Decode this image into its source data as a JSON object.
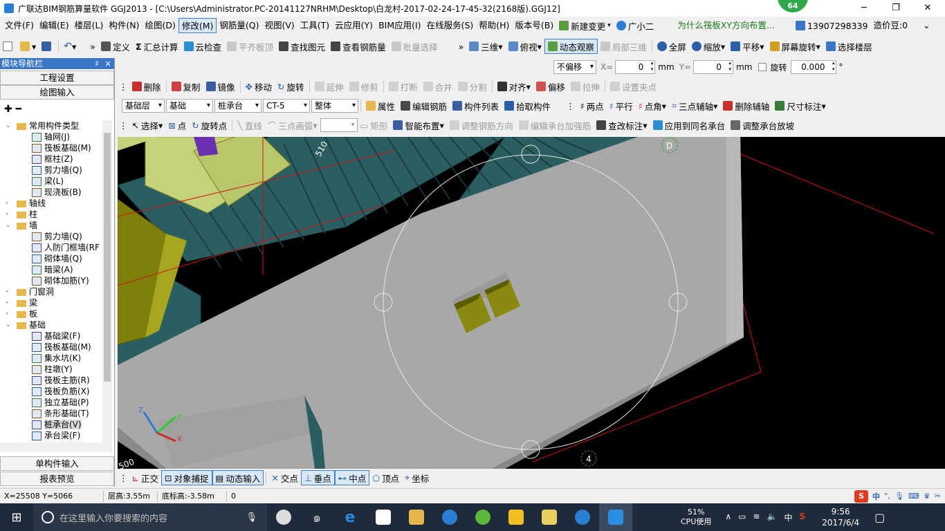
{
  "title_bar": {
    "title": "广联达BIM钢筋算量软件 GGJ2013 - [C:\\Users\\Administrator.PC-20141127NRHM\\Desktop\\白龙村-2017-02-24-17-45-32(2168版).GGJ12]",
    "badge": "64",
    "minimize": "─",
    "restore": "❐",
    "close": "✕"
  },
  "menu": {
    "items": [
      "文件(F)",
      "编辑(E)",
      "楼层(L)",
      "构件(N)",
      "绘图(D)",
      "修改(M)",
      "钢筋量(Q)",
      "视图(V)",
      "工具(T)",
      "云应用(Y)",
      "BIM应用(I)",
      "在线服务(S)",
      "帮助(H)",
      "版本号(B)",
      "新建变更",
      "广小二"
    ],
    "active": "修改(M)",
    "question": "为什么筏板XY方向布置...",
    "phone": "13907298339",
    "price": "造价豆:0"
  },
  "toolbar1": {
    "items": [
      "定义",
      "汇总计算",
      "云检查",
      "平齐板顶",
      "查找图元",
      "查看钢筋量",
      "批量选择",
      "三维",
      "俯视",
      "动态观察",
      "局部三维",
      "全屏",
      "缩放",
      "平移",
      "屏幕旋转",
      "选择楼层"
    ]
  },
  "toolbar_offset": {
    "mode": "不偏移",
    "x_label": "X=",
    "x_value": "0",
    "mm1": "mm",
    "y_label": "Y=",
    "y_value": "0",
    "mm2": "mm",
    "rotate_label": "旋转",
    "rotate_value": "0.000",
    "degree": "°"
  },
  "toolbar2": {
    "items": [
      "删除",
      "复制",
      "镜像",
      "移动",
      "旋转",
      "延伸",
      "修剪",
      "打断",
      "合并",
      "分割",
      "对齐",
      "偏移",
      "拉伸",
      "设置夹点"
    ]
  },
  "toolbar3": {
    "floor": "基础层",
    "category": "基础",
    "type": "桩承台",
    "name": "CT-5",
    "scope": "整体",
    "items": [
      "属性",
      "编辑钢筋",
      "构件列表",
      "拾取构件",
      "两点",
      "平行",
      "点角",
      "三点辅轴",
      "删除辅轴",
      "尺寸标注"
    ]
  },
  "toolbar4": {
    "items": [
      "选择",
      "点",
      "旋转点",
      "直线",
      "三点画弧",
      "矩形",
      "智能布置",
      "调整钢筋方向",
      "编辑承台加强筋",
      "查改标注",
      "应用到同名承台",
      "调整承台放坡"
    ]
  },
  "nav_panel": {
    "header": "模块导航栏",
    "pin": "♯",
    "close_glyph": "×",
    "buttons": [
      "工程设置",
      "绘图输入"
    ],
    "bottom_buttons": [
      "单构件输入",
      "报表预览"
    ],
    "tree": [
      {
        "level": 0,
        "expand": "⌄",
        "folder": true,
        "label": "常用构件类型"
      },
      {
        "level": 1,
        "label": "轴网(J)"
      },
      {
        "level": 1,
        "label": "筏板基础(M)"
      },
      {
        "level": 1,
        "label": "框柱(Z)"
      },
      {
        "level": 1,
        "label": "剪力墙(Q)"
      },
      {
        "level": 1,
        "label": "梁(L)"
      },
      {
        "level": 1,
        "label": "现浇板(B)"
      },
      {
        "level": 0,
        "expand": "›",
        "folder": true,
        "label": "轴线"
      },
      {
        "level": 0,
        "expand": "›",
        "folder": true,
        "label": "柱"
      },
      {
        "level": 0,
        "expand": "⌄",
        "folder": true,
        "label": "墙"
      },
      {
        "level": 1,
        "label": "剪力墙(Q)"
      },
      {
        "level": 1,
        "label": "人防门框墙(RF"
      },
      {
        "level": 1,
        "label": "砌体墙(Q)"
      },
      {
        "level": 1,
        "label": "暗梁(A)"
      },
      {
        "level": 1,
        "label": "砌体加筋(Y)"
      },
      {
        "level": 0,
        "expand": "›",
        "folder": true,
        "label": "门窗洞"
      },
      {
        "level": 0,
        "expand": "›",
        "folder": true,
        "label": "梁"
      },
      {
        "level": 0,
        "expand": "›",
        "folder": true,
        "label": "板"
      },
      {
        "level": 0,
        "expand": "⌄",
        "folder": true,
        "label": "基础"
      },
      {
        "level": 1,
        "label": "基础梁(F)"
      },
      {
        "level": 1,
        "label": "筏板基础(M)"
      },
      {
        "level": 1,
        "label": "集水坑(K)"
      },
      {
        "level": 1,
        "label": "柱墩(Y)"
      },
      {
        "level": 1,
        "label": "筏板主筋(R)"
      },
      {
        "level": 1,
        "label": "筏板负筋(X)"
      },
      {
        "level": 1,
        "label": "独立基础(P)"
      },
      {
        "level": 1,
        "label": "条形基础(T)"
      },
      {
        "level": 1,
        "label": "桩承台(V)",
        "selected": true
      },
      {
        "level": 1,
        "label": "承台梁(F)"
      }
    ]
  },
  "canvas": {
    "labels": [
      "D",
      "4",
      "500",
      "510"
    ],
    "axis": {
      "x": "X",
      "y": "Y",
      "z": "Z"
    }
  },
  "snap_bar": {
    "items": [
      "正交",
      "对象捕捉",
      "动态输入",
      "交点",
      "垂点",
      "中点",
      "顶点",
      "坐标"
    ]
  },
  "status": {
    "coords": "X=25508 Y=5066",
    "floor_height": "层高:3.55m",
    "bottom_height": "底标高:-3.58m",
    "value": "0"
  },
  "taskbar": {
    "search_placeholder": "在这里输入你要搜索的内容",
    "cpu_percent": "51%",
    "cpu_label": "CPU使用",
    "time": "9:56",
    "date": "2017/6/4",
    "ime": "中"
  },
  "colors": {
    "accent": "#3a76c8",
    "slab_gray": "#a8a8a8",
    "pile_olive": "#8a8a10",
    "teal": "#2a5e60",
    "grid_red": "#d01010",
    "green_badge": "#2ea84a"
  }
}
